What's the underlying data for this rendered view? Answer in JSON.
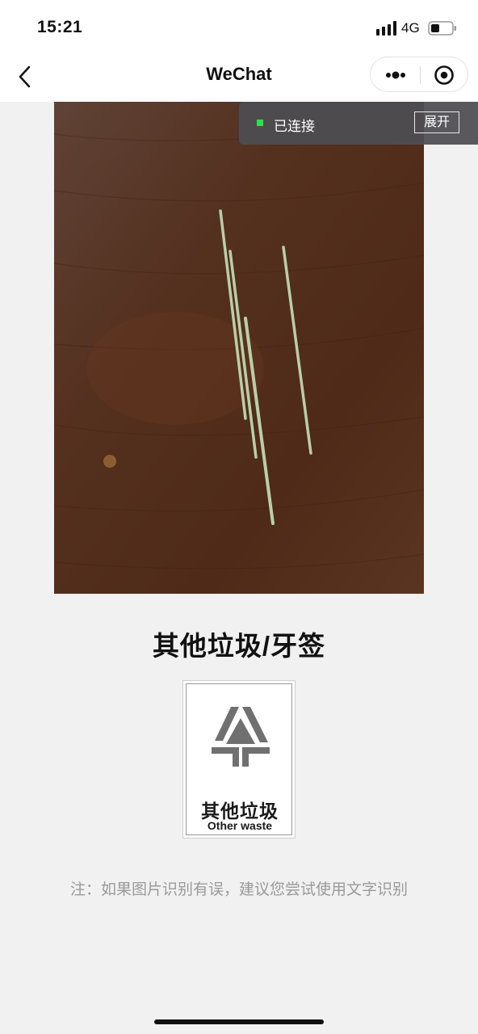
{
  "status_bar": {
    "time": "15:21",
    "network": "4G",
    "icons": [
      "signal-icon",
      "battery-icon"
    ]
  },
  "nav": {
    "title": "WeChat",
    "icons": [
      "back-icon",
      "more-icon",
      "close-icon"
    ]
  },
  "banner": {
    "status": "已连接",
    "expand_label": "展开",
    "dot_color": "#2ee04a"
  },
  "result": {
    "title": "其他垃圾/牙签"
  },
  "sign": {
    "cn": "其他垃圾",
    "en": "Other waste",
    "icon": "other-waste-icon"
  },
  "note": "注：如果图片识别有误，建议您尝试使用文字识别",
  "colors": {
    "background": "#f1f1f1",
    "note_text": "#9a9a9a"
  }
}
